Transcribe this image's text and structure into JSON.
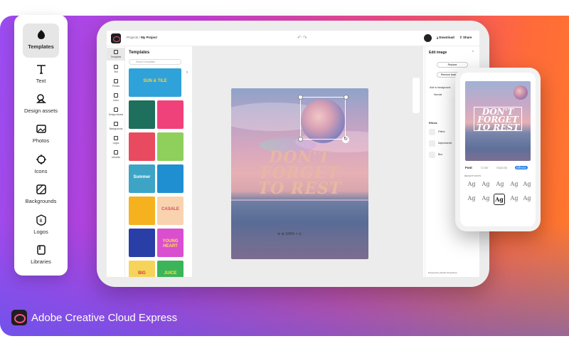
{
  "sidemenu": {
    "items": [
      {
        "label": "Templates",
        "icon": "templates-icon"
      },
      {
        "label": "Text",
        "icon": "text-icon"
      },
      {
        "label": "Design assets",
        "icon": "design-assets-icon"
      },
      {
        "label": "Photos",
        "icon": "photos-icon"
      },
      {
        "label": "Icons",
        "icon": "icons-icon"
      },
      {
        "label": "Backgrounds",
        "icon": "backgrounds-icon"
      },
      {
        "label": "Logos",
        "icon": "logos-icon"
      },
      {
        "label": "Libraries",
        "icon": "libraries-icon"
      }
    ]
  },
  "app": {
    "breadcrumb_root": "Projects",
    "breadcrumb_sep": "/",
    "project_name": "My Project",
    "download_label": "Download",
    "share_label": "Share"
  },
  "rail": {
    "items": [
      "Templates",
      "Text",
      "Photos",
      "Icons",
      "Design Assets",
      "Backgrounds",
      "Logos",
      "Libraries"
    ]
  },
  "templates_panel": {
    "title": "Templates",
    "search_placeholder": "Search templates",
    "tiles": [
      {
        "text": "SUN & TILE",
        "bg": "#2fa3d9",
        "fg": "#ffd23f"
      },
      {
        "text": "",
        "bg": "#f26b8a",
        "fg": "#ffffff"
      },
      {
        "text": "",
        "bg": "#1e6f5c",
        "fg": "#ffffff"
      },
      {
        "text": "",
        "bg": "#f0427a",
        "fg": "#ffffff"
      },
      {
        "text": "",
        "bg": "#e84b5f",
        "fg": "#ffffff"
      },
      {
        "text": "",
        "bg": "#8fcf5c",
        "fg": "#222222"
      },
      {
        "text": "Summer",
        "bg": "#3da4c6",
        "fg": "#ffffff"
      },
      {
        "text": "",
        "bg": "#1f8fd1",
        "fg": "#ffffff"
      },
      {
        "text": "",
        "bg": "#f5b21e",
        "fg": "#222222"
      },
      {
        "text": "CASALE",
        "bg": "#f9d3b0",
        "fg": "#d84a5c"
      },
      {
        "text": "",
        "bg": "#2a3ea8",
        "fg": "#ffffff"
      },
      {
        "text": "YOUNG HEART",
        "bg": "#d94fd0",
        "fg": "#ffe14a"
      },
      {
        "text": "BIG",
        "bg": "#f6d45a",
        "fg": "#d43a3a"
      },
      {
        "text": "JUICE",
        "bg": "#3cb55a",
        "fg": "#ffe14a"
      }
    ]
  },
  "canvas": {
    "poster_line1": "DON'T",
    "poster_line2": "FORGET",
    "poster_line3": "TO REST",
    "zoom": "100%"
  },
  "edit_panel": {
    "title": "Edit image",
    "replace_label": "Replace",
    "remove_bg_label": "Remove background",
    "add_bg_label": "Add to background",
    "blend_label": "Normal",
    "effects_title": "Effects",
    "effects": [
      "Filters",
      "Adjustments",
      "Blur"
    ],
    "powered_by": "Powered by Adobe Photoshop"
  },
  "phone": {
    "line1": "DON'T",
    "line2": "FORGET",
    "line3": "TO REST",
    "tabs": [
      "Font",
      "Color",
      "Opacity",
      "Effects"
    ],
    "sub_label": "RECENT FONTS",
    "font_glyph": "Ag"
  },
  "brand": {
    "name": "Adobe Creative Cloud Express"
  },
  "colors": {
    "accent_blue": "#2680eb",
    "brand_pink": "#fa4f8a"
  }
}
